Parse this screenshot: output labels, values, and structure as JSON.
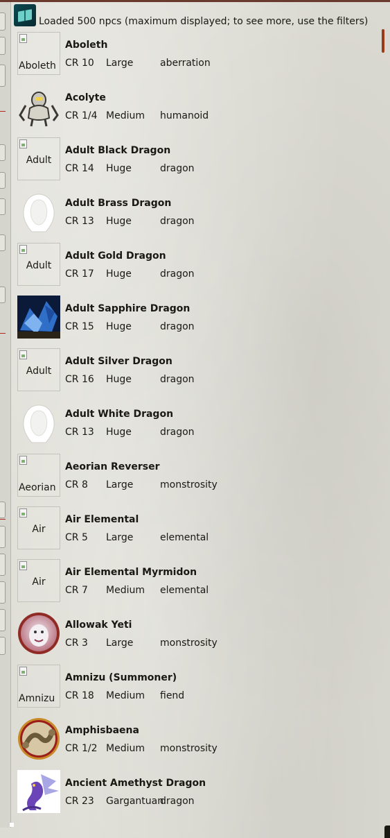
{
  "header": {
    "icon": "npc-book-icon",
    "status": "Loaded 500 npcs (maximum displayed; to see more, use the filters)"
  },
  "colors": {
    "accent": "#9c3b1c",
    "top_rule": "#6b3a2f",
    "background": "#dcdbd3"
  },
  "npcs": [
    {
      "name": "Aboleth",
      "cr": "CR 10",
      "size": "Large",
      "type": "aberration",
      "portrait": "broken",
      "alt": "Aboleth"
    },
    {
      "name": "Acolyte",
      "cr": "CR 1/4",
      "size": "Medium",
      "type": "humanoid",
      "portrait": "robot-token"
    },
    {
      "name": "Adult Black Dragon",
      "cr": "CR 14",
      "size": "Huge",
      "type": "dragon",
      "portrait": "broken",
      "alt": "Adult"
    },
    {
      "name": "Adult Brass Dragon",
      "cr": "CR 13",
      "size": "Huge",
      "type": "dragon",
      "portrait": "hooded-silhouette"
    },
    {
      "name": "Adult Gold Dragon",
      "cr": "CR 17",
      "size": "Huge",
      "type": "dragon",
      "portrait": "broken",
      "alt": "Adult"
    },
    {
      "name": "Adult Sapphire Dragon",
      "cr": "CR 15",
      "size": "Huge",
      "type": "dragon",
      "portrait": "sapphire-dragon-art"
    },
    {
      "name": "Adult Silver Dragon",
      "cr": "CR 16",
      "size": "Huge",
      "type": "dragon",
      "portrait": "broken",
      "alt": "Adult"
    },
    {
      "name": "Adult White Dragon",
      "cr": "CR 13",
      "size": "Huge",
      "type": "dragon",
      "portrait": "hooded-silhouette"
    },
    {
      "name": "Aeorian Reverser",
      "cr": "CR 8",
      "size": "Large",
      "type": "monstrosity",
      "portrait": "broken",
      "alt": "Aeorian"
    },
    {
      "name": "Air Elemental",
      "cr": "CR 5",
      "size": "Large",
      "type": "elemental",
      "portrait": "broken",
      "alt": "Air"
    },
    {
      "name": "Air Elemental Myrmidon",
      "cr": "CR 7",
      "size": "Medium",
      "type": "elemental",
      "portrait": "broken",
      "alt": "Air"
    },
    {
      "name": "Allowak Yeti",
      "cr": "CR 3",
      "size": "Large",
      "type": "monstrosity",
      "portrait": "yeti-token"
    },
    {
      "name": "Amnizu (Summoner)",
      "cr": "CR 18",
      "size": "Medium",
      "type": "fiend",
      "portrait": "broken",
      "alt": "Amnizu"
    },
    {
      "name": "Amphisbaena",
      "cr": "CR 1/2",
      "size": "Medium",
      "type": "monstrosity",
      "portrait": "amphisbaena-token"
    },
    {
      "name": "Ancient Amethyst Dragon",
      "cr": "CR 23",
      "size": "Gargantuan",
      "type": "dragon",
      "portrait": "amethyst-dragon-art"
    }
  ]
}
